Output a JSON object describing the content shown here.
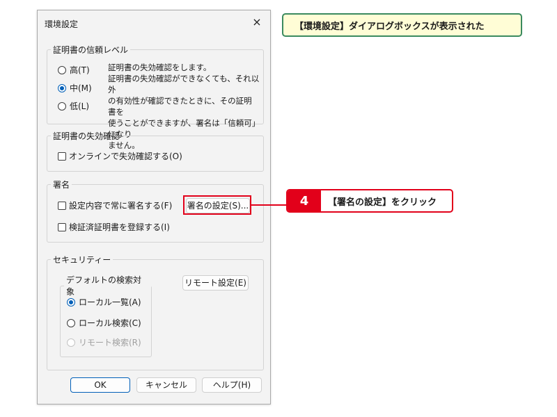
{
  "dialog": {
    "title": "環境設定",
    "close_icon": "×"
  },
  "trust_level": {
    "legend": "証明書の信頼レベル",
    "options": [
      {
        "label": "高(T)",
        "selected": false
      },
      {
        "label": "中(M)",
        "selected": true
      },
      {
        "label": "低(L)",
        "selected": false
      }
    ],
    "description_lines": [
      "証明書の失効確認をします。",
      "証明書の失効確認ができなくても、それ以外",
      "の有効性が確認できたときに、その証明書を",
      "使うことができますが、署名は「信頼可」になり",
      "ません。"
    ]
  },
  "revocation": {
    "legend": "証明書の失効確認",
    "online_check_label": "オンラインで失効確認する(O)",
    "online_check_checked": false
  },
  "signature": {
    "legend": "署名",
    "always_sign_label": "設定内容で常に署名する(F)",
    "always_sign_checked": false,
    "register_label": "検証済証明書を登録する(I)",
    "register_checked": false,
    "settings_button": "署名の設定(S)..."
  },
  "security": {
    "legend": "セキュリティー",
    "search_target": {
      "legend": "デフォルトの検索対象",
      "options": [
        {
          "label": "ローカル一覧(A)",
          "selected": true,
          "enabled": true
        },
        {
          "label": "ローカル検索(C)",
          "selected": false,
          "enabled": true
        },
        {
          "label": "リモート検索(R)",
          "selected": false,
          "enabled": false
        }
      ]
    },
    "remote_settings_button": "リモート設定(E)"
  },
  "buttons": {
    "ok": "OK",
    "cancel": "キャンセル",
    "help": "ヘルプ(H)"
  },
  "callouts": {
    "top": "【環境設定】ダイアログボックスが表示された",
    "step_number": "4",
    "step_text": "【署名の設定】をクリック"
  },
  "colors": {
    "accent_blue": "#005fb8",
    "callout_red": "#e2001a",
    "callout_green_border": "#3a8a5e",
    "callout_yellow_bg": "#fffdd6"
  }
}
